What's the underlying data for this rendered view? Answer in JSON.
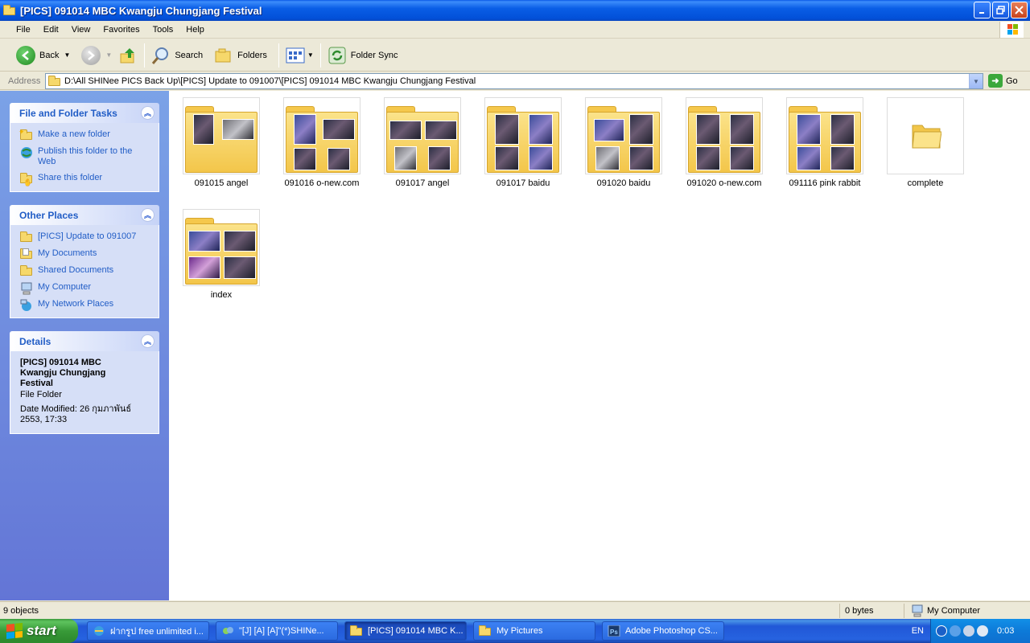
{
  "window": {
    "title": "[PICS] 091014 MBC Kwangju Chungjang Festival"
  },
  "menu": [
    "File",
    "Edit",
    "View",
    "Favorites",
    "Tools",
    "Help"
  ],
  "toolbar": {
    "back": "Back",
    "search": "Search",
    "folders": "Folders",
    "folder_sync": "Folder Sync"
  },
  "address": {
    "label": "Address",
    "path": "D:\\All SHINee PICS Back Up\\[PICS] Update to 091007\\[PICS] 091014 MBC Kwangju Chungjang Festival",
    "go": "Go"
  },
  "tasks": {
    "title": "File and Folder Tasks",
    "items": [
      "Make a new folder",
      "Publish this folder to the Web",
      "Share this folder"
    ]
  },
  "places": {
    "title": "Other Places",
    "items": [
      "[PICS] Update to 091007",
      "My Documents",
      "Shared Documents",
      "My Computer",
      "My Network Places"
    ]
  },
  "details": {
    "title": "Details",
    "name": "[PICS] 091014 MBC Kwangju Chungjang Festival",
    "type": "File Folder",
    "modified": "Date Modified: 26 กุมภาพันธ์ 2553, 17:33"
  },
  "items": [
    {
      "label": "091015 angel"
    },
    {
      "label": "091016 o-new.com"
    },
    {
      "label": "091017 angel"
    },
    {
      "label": "091017 baidu"
    },
    {
      "label": "091020 baidu"
    },
    {
      "label": "091020 o-new.com"
    },
    {
      "label": "091116 pink rabbit"
    },
    {
      "label": "complete"
    },
    {
      "label": "index"
    }
  ],
  "status": {
    "objects": "9 objects",
    "size": "0 bytes",
    "location": "My Computer"
  },
  "taskbar": {
    "start": "start",
    "tasks": [
      "ฝากรูป free unlimited i...",
      "\"[J] [A] [A]\"(*)SHINe...",
      "[PICS] 091014 MBC K...",
      "My Pictures",
      "Adobe Photoshop CS..."
    ],
    "lang": "EN",
    "clock": "0:03"
  },
  "colors": {
    "titlebar": "#0a5ee6",
    "task_link": "#215dc6",
    "start_green": "#389a38"
  }
}
